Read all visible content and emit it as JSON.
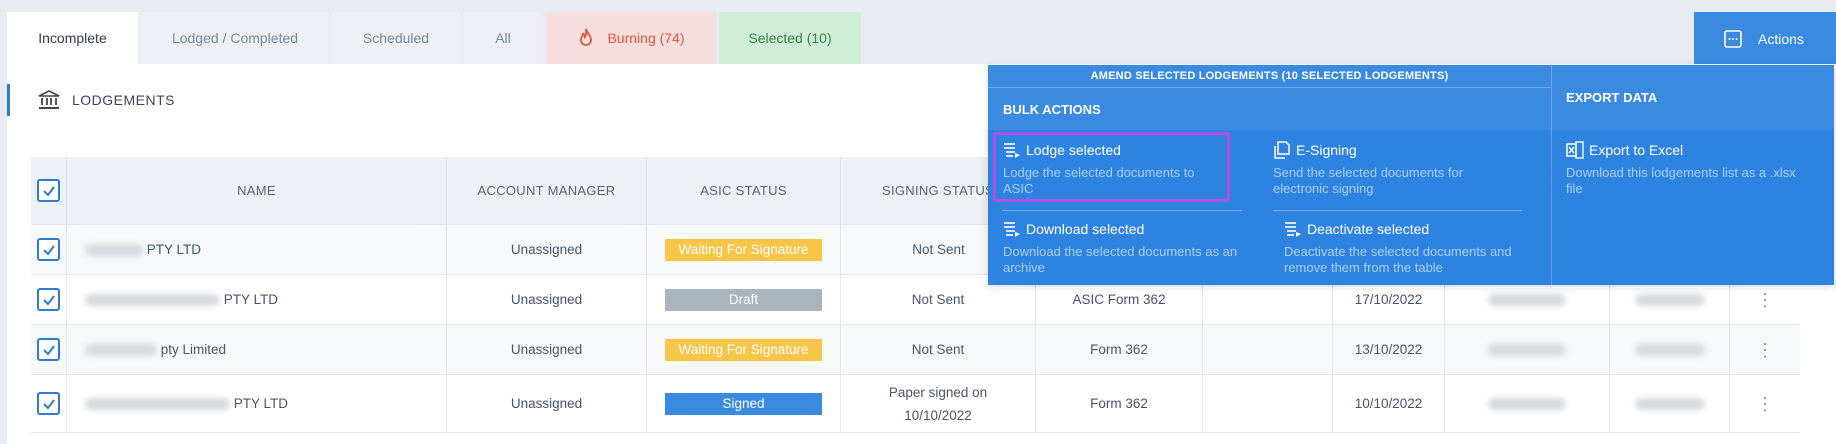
{
  "tabs": [
    {
      "label": "Incomplete"
    },
    {
      "label": "Lodged / Completed"
    },
    {
      "label": "Scheduled"
    },
    {
      "label": "All"
    },
    {
      "label": "Burning (74)"
    },
    {
      "label": "Selected (10)"
    }
  ],
  "section": {
    "title": "LODGEMENTS"
  },
  "actions_button": {
    "label": "Actions"
  },
  "table": {
    "headers": [
      "NAME",
      "ACCOUNT MANAGER",
      "ASIC STATUS",
      "SIGNING STATUS"
    ],
    "rows": [
      {
        "name_suffix": "PTY LTD",
        "manager": "Unassigned",
        "asic_status": "Waiting For Signature",
        "signing_status": "Not Sent",
        "form": "",
        "date": ""
      },
      {
        "name_suffix": "PTY LTD",
        "manager": "Unassigned",
        "asic_status": "Draft",
        "signing_status": "Not Sent",
        "form": "ASIC Form 362",
        "date": "17/10/2022"
      },
      {
        "name_suffix": "pty Limited",
        "manager": "Unassigned",
        "asic_status": "Waiting For Signature",
        "signing_status": "Not Sent",
        "form": "Form 362",
        "date": "13/10/2022"
      },
      {
        "name_suffix": "PTY LTD",
        "manager": "Unassigned",
        "asic_status": "Signed",
        "signing_status_line1": "Paper signed on",
        "signing_status_line2": "10/10/2022",
        "form": "Form 362",
        "date": "10/10/2022"
      }
    ]
  },
  "status_colors": {
    "Waiting For Signature": "#f7c548",
    "Draft": "#aab4bf",
    "Signed": "#3a8ae2"
  },
  "dropdown": {
    "top_label": "AMEND SELECTED LODGEMENTS (10 SELECTED LODGEMENTS)",
    "bulk_heading": "BULK ACTIONS",
    "export_heading": "EXPORT DATA",
    "actions": {
      "lodge": {
        "title": "Lodge selected",
        "desc": "Lodge the selected documents to ASIC"
      },
      "esign": {
        "title": "E-Signing",
        "desc_line1": "Send the selected documents for",
        "desc_line2": "electronic signing"
      },
      "download": {
        "title": "Download selected",
        "desc_line1": "Download the selected documents as an",
        "desc_line2": "archive"
      },
      "deactivate": {
        "title": "Deactivate selected",
        "desc_line1": "Deactivate the selected documents and",
        "desc_line2": "remove them from the table"
      },
      "export": {
        "title": "Export to Excel",
        "desc_line1": "Download this lodgements list as a .xlsx",
        "desc_line2": "file"
      }
    }
  },
  "icons": [
    "flame-icon",
    "bank-icon",
    "checkbox-icon",
    "list-icon",
    "document-icon",
    "excel-icon",
    "kebab-menu-icon",
    "actions-icon"
  ],
  "accent": "#3a8ae2",
  "highlight": "#b04fe6"
}
